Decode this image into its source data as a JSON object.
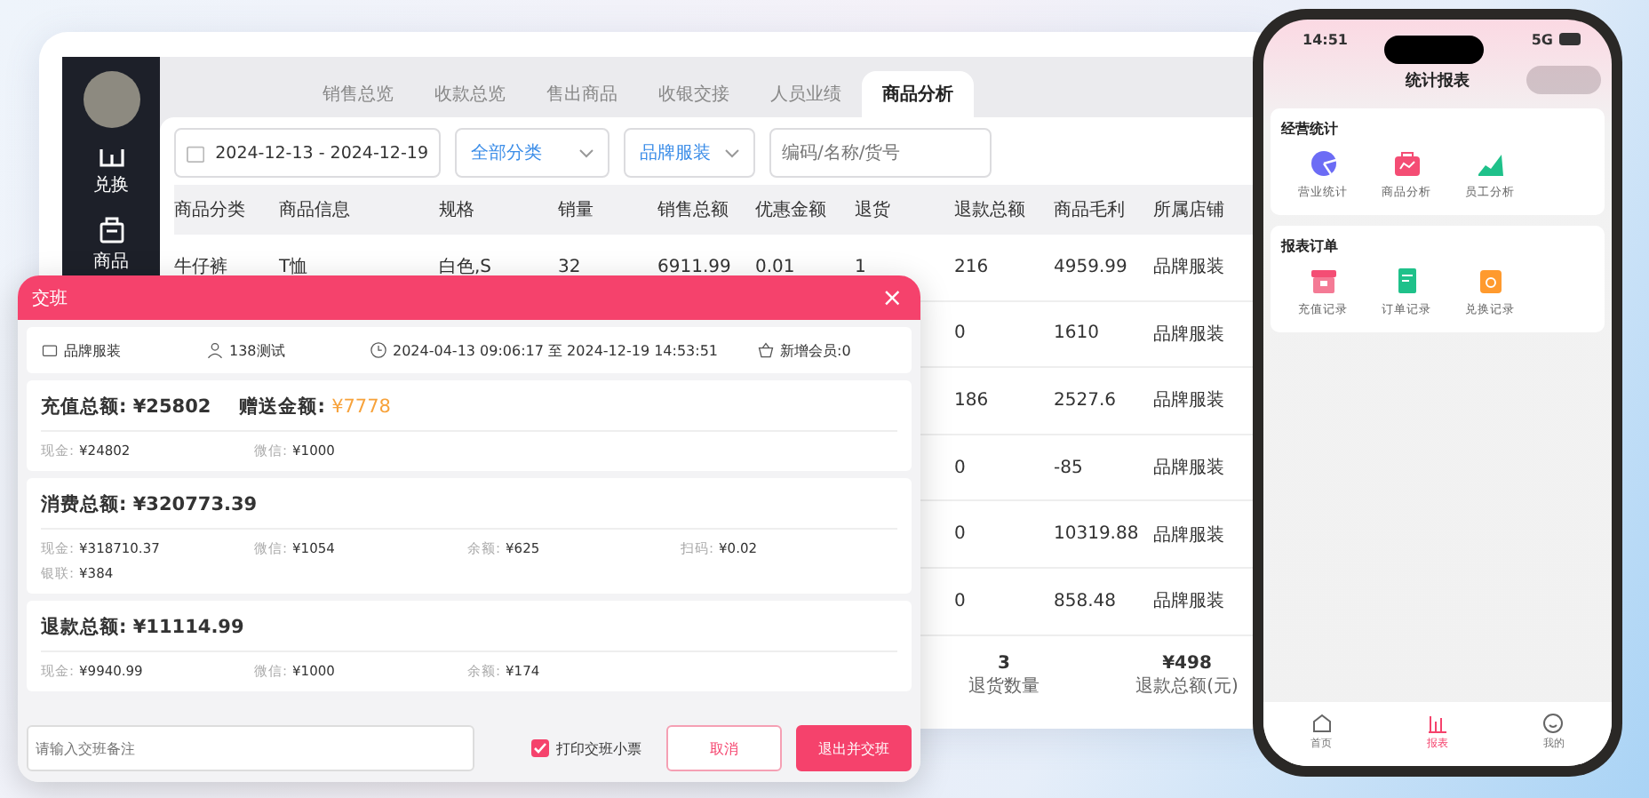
{
  "desktop": {
    "sidebar": {
      "items": [
        {
          "label": "兑换"
        },
        {
          "label": "商品"
        }
      ]
    },
    "tabs": [
      {
        "label": "销售总览",
        "selected": false
      },
      {
        "label": "收款总览",
        "selected": false
      },
      {
        "label": "售出商品",
        "selected": false
      },
      {
        "label": "收银交接",
        "selected": false
      },
      {
        "label": "人员业绩",
        "selected": false
      },
      {
        "label": "商品分析",
        "selected": true
      }
    ],
    "filters": {
      "date_range": "2024-12-13 - 2024-12-19",
      "category": "全部分类",
      "store": "品牌服装",
      "search": {
        "placeholder": "编码/名称/货号"
      }
    },
    "table": {
      "columns": [
        "商品分类",
        "商品信息",
        "规格",
        "销量",
        "销售总额",
        "优惠金额",
        "退货",
        "退款总额",
        "商品毛利",
        "所属店铺"
      ],
      "rows": [
        {
          "cells": [
            "牛仔裤",
            "T恤",
            "白色,S",
            "32",
            "6911.99",
            "0.01",
            "1",
            "216",
            "4959.99",
            "品牌服装"
          ]
        },
        {
          "cells": [
            "0",
            "1610",
            "品牌服装"
          ]
        },
        {
          "cells": [
            "186",
            "2527.6",
            "品牌服装"
          ]
        },
        {
          "cells": [
            "0",
            "-85",
            "品牌服装"
          ]
        },
        {
          "cells": [
            "0",
            "10319.88",
            "品牌服装"
          ]
        },
        {
          "cells": [
            "0",
            "858.48",
            "品牌服装"
          ]
        }
      ]
    },
    "summary": [
      {
        "value": "3",
        "label": "退货数量"
      },
      {
        "value": "¥498",
        "label": "退款总额(元)"
      }
    ]
  },
  "dialog": {
    "title": "交班",
    "close": "×",
    "info": [
      "品牌服装",
      "138测试",
      "2024-04-13 09:06:17 至 2024-12-19 14:53:51",
      "新增会员:0"
    ],
    "sections": [
      {
        "totals": [
          {
            "label": "充值总额: ",
            "value": "¥25802",
            "highlight": false
          },
          {
            "label": "赠送金额: ",
            "value": "¥7778",
            "highlight": true
          }
        ],
        "items": [
          {
            "label": "现金:",
            "value": "¥24802"
          },
          {
            "label": "微信:",
            "value": "¥1000"
          }
        ]
      },
      {
        "totals": [
          {
            "label": "消费总额: ",
            "value": "¥320773.39",
            "highlight": false
          }
        ],
        "items": [
          {
            "label": "现金:",
            "value": "¥318710.37"
          },
          {
            "label": "微信:",
            "value": "¥1054"
          },
          {
            "label": "余额:",
            "value": "¥625"
          },
          {
            "label": "扫码:",
            "value": "¥0.02"
          },
          {
            "label": "银联:",
            "value": "¥384"
          }
        ]
      },
      {
        "totals": [
          {
            "label": "退款总额: ",
            "value": "¥11114.99",
            "highlight": false
          }
        ],
        "items": [
          {
            "label": "现金:",
            "value": "¥9940.99"
          },
          {
            "label": "微信:",
            "value": "¥1000"
          },
          {
            "label": "余额:",
            "value": "¥174"
          }
        ]
      }
    ],
    "remark": {
      "placeholder": "请输入交班备注"
    },
    "print_receipt": {
      "label": "打印交班小票",
      "checked": true
    },
    "buttons": [
      {
        "label": "取消",
        "kind": "secondary"
      },
      {
        "label": "退出并交班",
        "kind": "primary"
      }
    ]
  },
  "phone": {
    "status_time": "14:51",
    "network": "5G",
    "title": "统计报表",
    "cards": [
      {
        "title": "经营统计",
        "items": [
          "营业统计",
          "商品分析",
          "员工分析"
        ]
      },
      {
        "title": "报表订单",
        "items": [
          "充值记录",
          "订单记录",
          "兑换记录"
        ]
      }
    ],
    "tabbar": [
      {
        "label": "首页",
        "selected": false
      },
      {
        "label": "报表",
        "selected": true
      },
      {
        "label": "我的",
        "selected": false
      }
    ]
  }
}
